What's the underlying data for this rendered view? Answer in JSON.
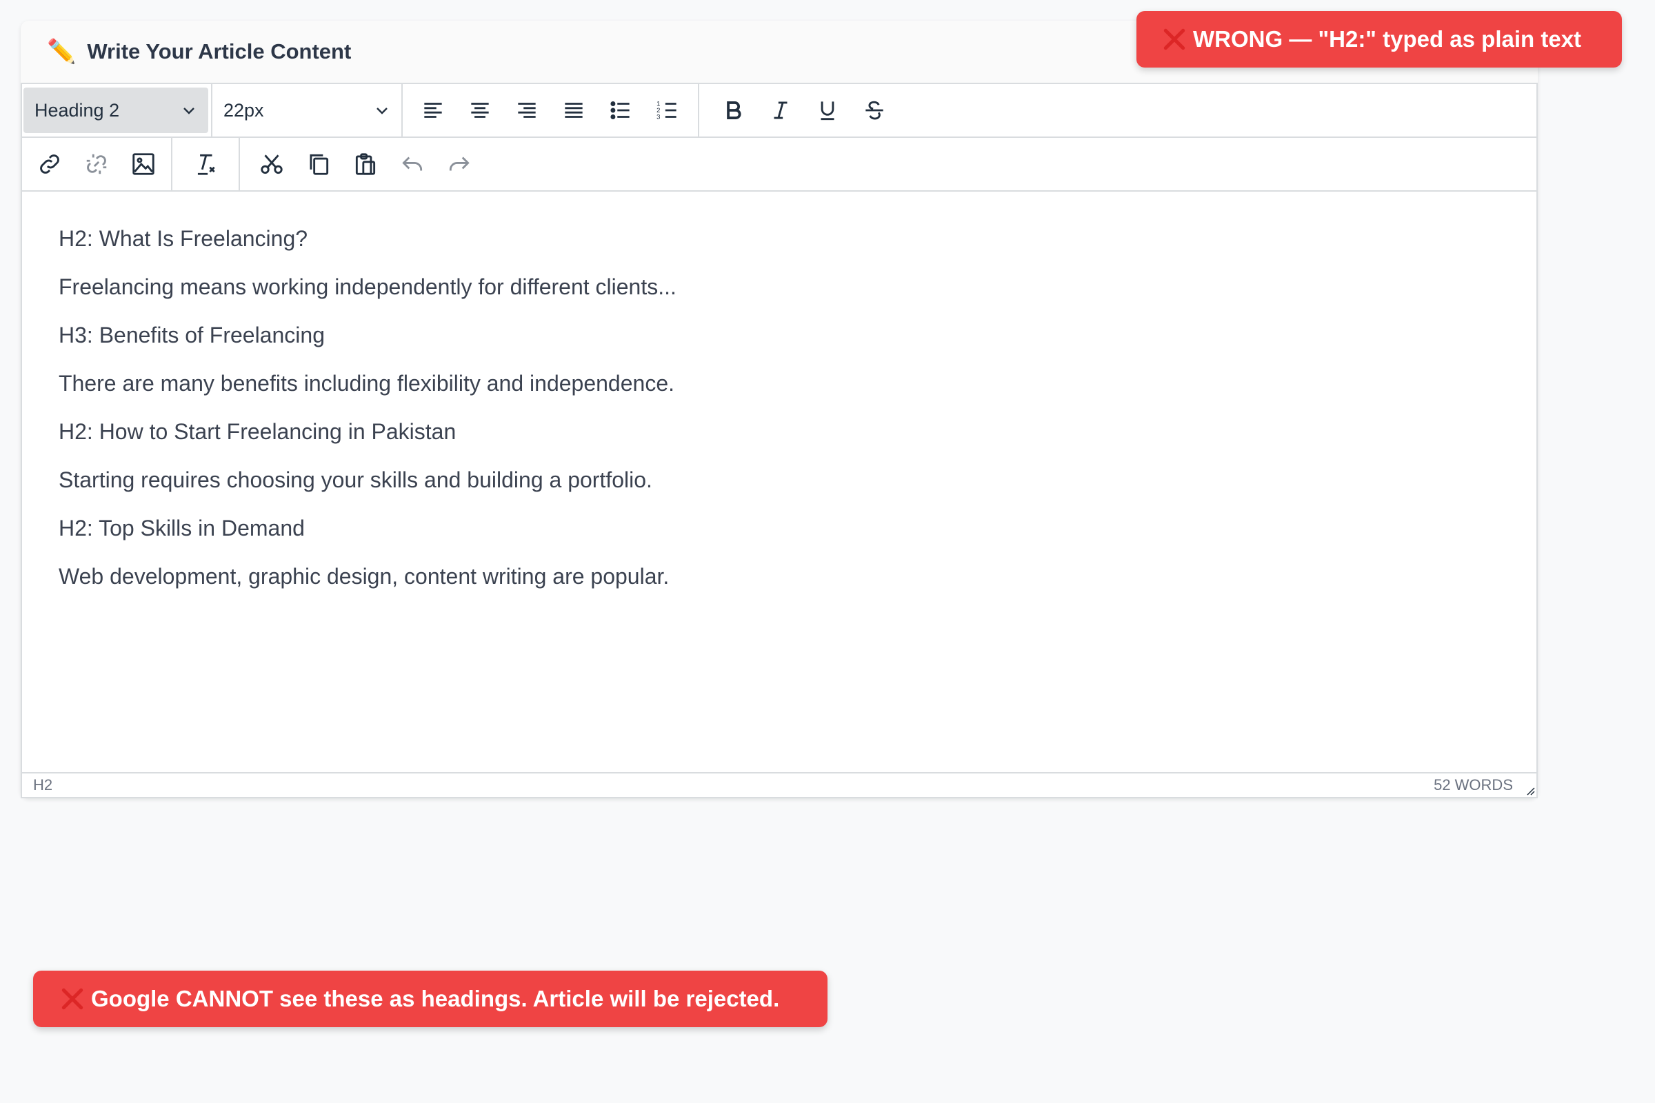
{
  "card": {
    "title": "Write Your Article Content",
    "icon": "pencil-icon"
  },
  "toolbar": {
    "block_format": "Heading 2",
    "font_size": "22px",
    "icons": [
      "align-left-icon",
      "align-center-icon",
      "align-right-icon",
      "align-justify-icon",
      "bullet-list-icon",
      "numbered-list-icon",
      "bold-icon",
      "italic-icon",
      "underline-icon",
      "strikethrough-icon",
      "link-icon",
      "unlink-icon",
      "image-icon",
      "clear-formatting-icon",
      "cut-icon",
      "copy-icon",
      "paste-icon",
      "undo-icon",
      "redo-icon"
    ]
  },
  "content": {
    "paragraphs": [
      "H2: What Is Freelancing?",
      "Freelancing means working independently for different clients...",
      "H3: Benefits of Freelancing",
      "There are many benefits including flexibility and independence.",
      "H2: How to Start Freelancing in Pakistan",
      "Starting requires choosing your skills and building a portfolio.",
      "H2: Top Skills in Demand",
      "Web development, graphic design, content writing are popular."
    ]
  },
  "status": {
    "path": "H2",
    "word_count": "52 WORDS"
  },
  "badges": {
    "top": "WRONG — \"H2:\" typed as plain text",
    "bottom": "Google CANNOT see these as headings. Article will be rejected."
  },
  "colors": {
    "badge_bg": "#ef4444",
    "badge_text": "#ffffff",
    "x_mark": "#ef4444"
  }
}
